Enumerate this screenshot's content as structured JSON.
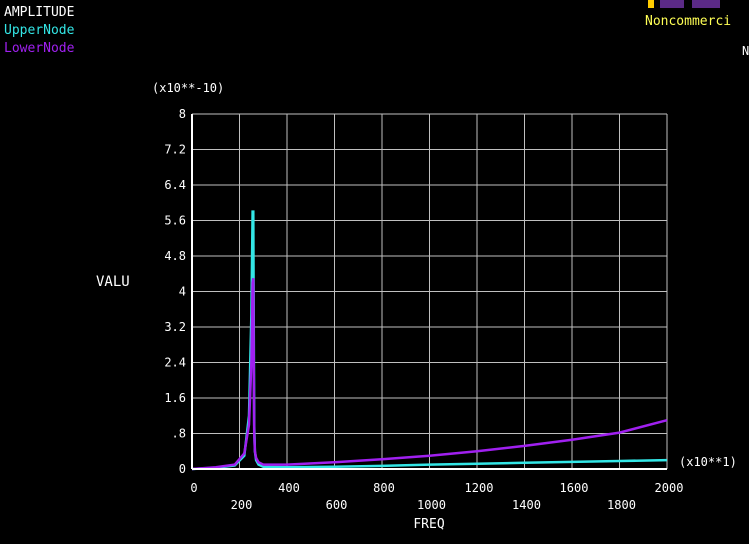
{
  "header": {
    "title": "AMPLITUDE",
    "legend": [
      {
        "name": "UpperNode",
        "color": "#33e6e6"
      },
      {
        "name": "LowerNode",
        "color": "#a020f0"
      }
    ],
    "watermark_text": "Noncommerci",
    "corner_letter": "N"
  },
  "chart_data": {
    "type": "line",
    "title": "AMPLITUDE",
    "xlabel": "FREQ",
    "ylabel": "VALU",
    "y_multiplier": "(x10**-10)",
    "x_multiplier": "(x10**1)",
    "xlim": [
      0,
      2000
    ],
    "ylim": [
      0,
      8
    ],
    "x_ticks": [
      "0",
      "200",
      "400",
      "600",
      "800",
      "1000",
      "1200",
      "1400",
      "1600",
      "1800",
      "2000"
    ],
    "y_ticks": [
      "0",
      ".8",
      "1.6",
      "2.4",
      "3.2",
      "4",
      "4.8",
      "5.6",
      "6.4",
      "7.2",
      "8"
    ],
    "grid": true,
    "legend_position": "top-left",
    "series": [
      {
        "name": "UpperNode",
        "color": "#33e6e6",
        "x": [
          0,
          100,
          180,
          220,
          240,
          250,
          255,
          258,
          260,
          262,
          265,
          270,
          280,
          300,
          400,
          600,
          800,
          1000,
          1200,
          1400,
          1600,
          1800,
          2000
        ],
        "y": [
          0,
          0.03,
          0.08,
          0.3,
          1.2,
          3.5,
          5.8,
          5.8,
          3.0,
          1.0,
          0.4,
          0.2,
          0.1,
          0.05,
          0.04,
          0.05,
          0.07,
          0.1,
          0.12,
          0.14,
          0.16,
          0.18,
          0.2
        ]
      },
      {
        "name": "LowerNode",
        "color": "#a020f0",
        "x": [
          0,
          100,
          180,
          220,
          240,
          250,
          255,
          258,
          260,
          262,
          265,
          270,
          280,
          300,
          400,
          600,
          800,
          1000,
          1200,
          1400,
          1600,
          1800,
          2000
        ],
        "y": [
          0,
          0.04,
          0.1,
          0.35,
          1.0,
          2.4,
          4.2,
          4.3,
          2.2,
          0.8,
          0.4,
          0.25,
          0.15,
          0.1,
          0.1,
          0.15,
          0.22,
          0.3,
          0.4,
          0.52,
          0.66,
          0.82,
          1.1
        ]
      }
    ]
  }
}
